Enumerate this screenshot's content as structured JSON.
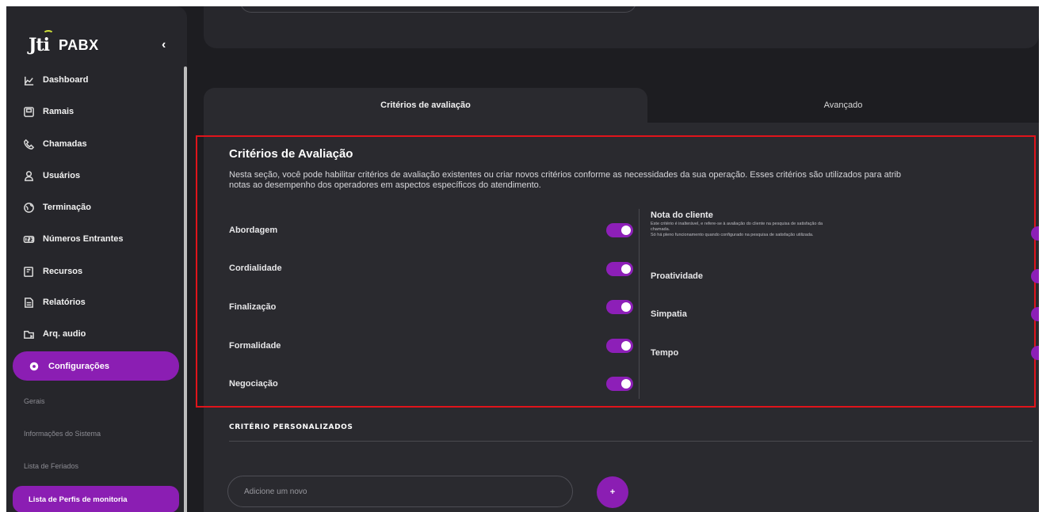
{
  "brand": {
    "logo_mark": "Jti",
    "product": "PABX",
    "collapse_glyph": "‹"
  },
  "sidebar": {
    "items": [
      {
        "label": "Dashboard",
        "icon": "dashboard-icon"
      },
      {
        "label": "Ramais",
        "icon": "extension-icon"
      },
      {
        "label": "Chamadas",
        "icon": "phone-icon"
      },
      {
        "label": "Usuários",
        "icon": "user-icon"
      },
      {
        "label": "Terminação",
        "icon": "globe-icon"
      },
      {
        "label": "Números Entrantes",
        "icon": "number-icon"
      },
      {
        "label": "Recursos",
        "icon": "resources-icon"
      },
      {
        "label": "Relatórios",
        "icon": "report-icon"
      },
      {
        "label": "Arq. audio",
        "icon": "audio-folder-icon"
      }
    ],
    "active": {
      "label": "Configurações",
      "icon": "gear-icon"
    },
    "sub_items": [
      "Gerais",
      "Informações do Sistema",
      "Lista de Feriados"
    ],
    "sub_active": "Lista de Perfis de monitoria"
  },
  "tabs": [
    {
      "label": "Critérios de avaliação",
      "active": true
    },
    {
      "label": "Avançado",
      "active": false
    }
  ],
  "criteria": {
    "title": "Critérios de Avaliação",
    "description_line1": "Nesta seção, você pode habilitar critérios de avaliação existentes ou criar novos critérios conforme as necessidades da sua operação. Esses critérios são utilizados para atrib",
    "description_line2": "notas ao desempenho dos operadores em aspectos específicos do atendimento.",
    "left": [
      {
        "label": "Abordagem",
        "enabled": true
      },
      {
        "label": "Cordialidade",
        "enabled": true
      },
      {
        "label": "Finalização",
        "enabled": true
      },
      {
        "label": "Formalidade",
        "enabled": true
      },
      {
        "label": "Negociação",
        "enabled": true
      }
    ],
    "nota": {
      "label": "Nota do cliente",
      "note_line1": "Este critério é inalterável, e refere-se à avaliação do cliente na pesquisa de satisfação da",
      "note_line2": "chamada.",
      "note_line3": "Só há pleno funcionamento quando configurado na pesquisa de satisfação utilizada.",
      "enabled": true
    },
    "right": [
      {
        "label": "Proatividade",
        "enabled": true
      },
      {
        "label": "Simpatia",
        "enabled": true
      },
      {
        "label": "Tempo",
        "enabled": true
      }
    ]
  },
  "custom": {
    "title": "CRITÉRIO PERSONALIZADOS",
    "input_placeholder": "Adicione um novo",
    "add_label": "+"
  },
  "colors": {
    "accent": "#8b1eb3",
    "highlight_border": "#e0141b",
    "background": "#1d1d21",
    "panel": "#2a2a2f"
  }
}
